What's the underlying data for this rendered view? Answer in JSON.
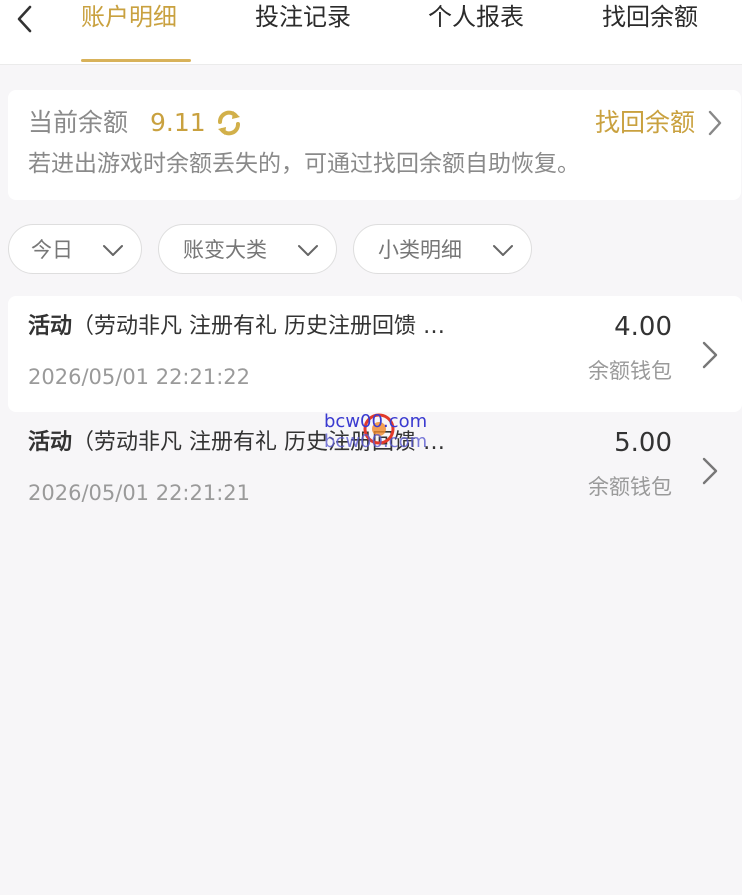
{
  "tabs": [
    {
      "label": "账户明细",
      "active": true
    },
    {
      "label": "投注记录",
      "active": false
    },
    {
      "label": "个人报表",
      "active": false
    },
    {
      "label": "找回余额",
      "active": false
    }
  ],
  "balance": {
    "label": "当前余额",
    "value": "9.11",
    "recover_label": "找回余额",
    "description": "若进出游戏时余额丢失的，可通过找回余额自助恢复。"
  },
  "filters": [
    {
      "label": "今日"
    },
    {
      "label": "账变大类"
    },
    {
      "label": "小类明细"
    }
  ],
  "records": [
    {
      "category": "活动",
      "detail": "（劳动非凡 注册有礼 历史注册回馈 …",
      "time": "2026/05/01 22:21:22",
      "amount": "4.00",
      "wallet": "余额钱包"
    },
    {
      "category": "活动",
      "detail": "（劳动非凡 注册有礼 历史注册回馈 …",
      "time": "2026/05/01 22:21:21",
      "amount": "5.00",
      "wallet": "余额钱包"
    }
  ],
  "watermark": {
    "text": "bcw00.com"
  },
  "colors": {
    "accent": "#c9a13f",
    "background": "#f7f6f8",
    "card": "#ffffff",
    "text": "#333333",
    "muted": "#9a9a9a"
  },
  "icons": {
    "back": "chevron-left-icon",
    "refresh": "refresh-icon",
    "chevron_right": "chevron-right-icon",
    "chevron_down": "chevron-down-icon"
  }
}
